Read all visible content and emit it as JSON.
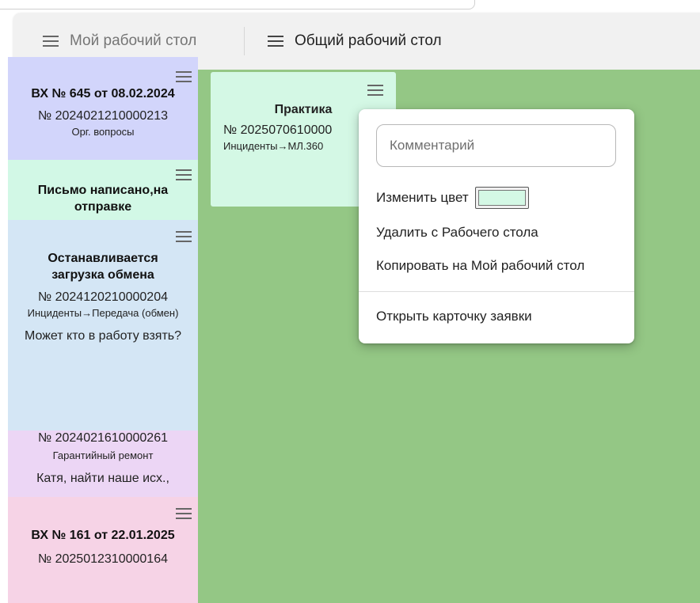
{
  "tabs": {
    "my": "Мой рабочий стол",
    "common": "Общий рабочий стол"
  },
  "cards": [
    {
      "title": "ВХ № 645 от 08.02.2024",
      "number": "№ 2024021210000213",
      "category": "Орг. вопросы",
      "color": "#d2d5fb"
    },
    {
      "title": "Письмо написано,на отправке",
      "color": "#d2f8e6"
    },
    {
      "title": "Останавливается загрузка обмена",
      "number": "№ 2024120210000204",
      "category": "Инциденты→Передача (обмен)",
      "comment": "Может кто в работу взять?",
      "color": "#d4e6f5"
    },
    {
      "number": "№ 2024021610000261",
      "category": "Гарантийный ремонт",
      "comment": "Катя, найти наше исх.,",
      "color": "#ecd6f5"
    },
    {
      "title": "ВХ № 161 от 22.01.2025",
      "number": "№ 2025012310000164",
      "color": "#f6d3e6"
    }
  ],
  "practice_card": {
    "title": "Практика",
    "number": "№ 2025070610000",
    "category": "Инциденты→МЛ.360",
    "color": "#d4f8e5"
  },
  "board_color": "#94c785",
  "context_menu": {
    "comment_placeholder": "Комментарий",
    "change_color": "Изменить цвет",
    "current_color": "#d4f8e5",
    "remove": "Удалить с Рабочего стола",
    "copy": "Копировать на Мой рабочий стол",
    "open": "Открыть карточку заявки"
  }
}
